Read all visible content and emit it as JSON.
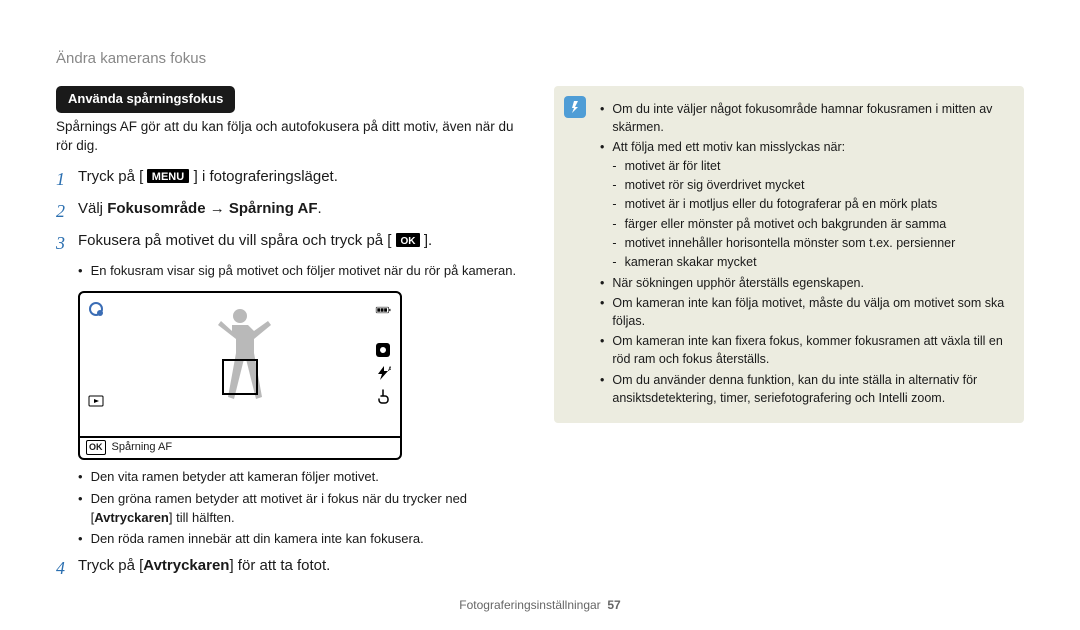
{
  "breadcrumb": "Ändra kamerans fokus",
  "pill": "Använda spårningsfokus",
  "intro": "Spårnings AF gör att du kan följa och autofokusera på ditt motiv, även när du rör dig.",
  "steps": {
    "s1_a": "Tryck på [",
    "s1_b": "] i fotograferingsläget.",
    "s2_a": "Välj ",
    "s2_bold": "Fokusområde → Spårning AF",
    "s2_c": ".",
    "s3_a": "Fokusera på motivet du vill spåra och tryck på [",
    "s3_b": "].",
    "s3_sub": "En fokusram visar sig på motivet och följer motivet när du rör på kameran.",
    "s4_a": "Tryck på [",
    "s4_bold": "Avtryckaren",
    "s4_b": "] för att ta fotot."
  },
  "screen_caption": "Spårning AF",
  "frame_notes": {
    "a": "Den vita ramen betyder att kameran följer motivet.",
    "b_a": "Den gröna ramen betyder att motivet är i fokus när du trycker ned [",
    "b_bold": "Avtryckaren",
    "b_b": "] till hälften.",
    "c": "Den röda ramen innebär att din kamera inte kan fokusera."
  },
  "note": {
    "l1": "Om du inte väljer något fokusområde hamnar fokusramen i mitten av skärmen.",
    "l2": "Att följa med ett motiv kan misslyckas när:",
    "l2d": {
      "a": "motivet är för litet",
      "b": "motivet rör sig överdrivet mycket",
      "c": "motivet är i motljus eller du fotograferar på en mörk plats",
      "d": "färger eller mönster på motivet och bakgrunden är samma",
      "e": "motivet innehåller horisontella mönster som t.ex. persienner",
      "f": "kameran skakar mycket"
    },
    "l3": "När sökningen upphör återställs egenskapen.",
    "l4": "Om kameran inte kan följa motivet, måste du välja om motivet som ska följas.",
    "l5": "Om kameran inte kan fixera fokus, kommer fokusramen att växla till en röd ram och fokus återställs.",
    "l6": "Om du använder denna funktion, kan du inte ställa in alternativ för ansiktsdetektering, timer, seriefotografering och Intelli zoom."
  },
  "footer_a": "Fotograferingsinställningar",
  "footer_b": "57"
}
